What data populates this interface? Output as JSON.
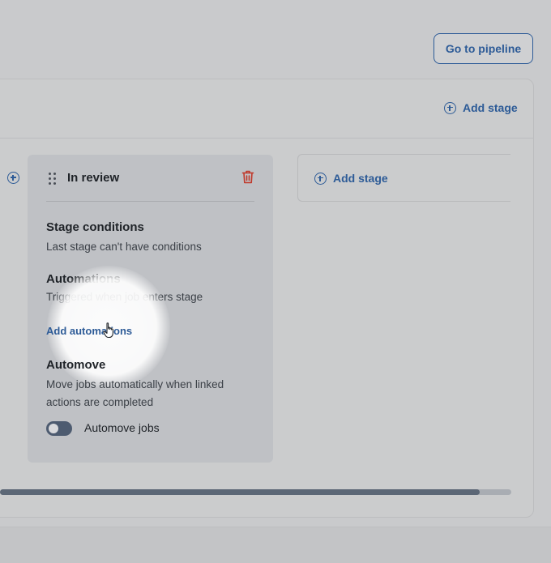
{
  "header": {
    "go_pipeline_label": "Go to pipeline",
    "add_stage_label": "Add stage"
  },
  "stage_card": {
    "title": "In review",
    "conditions": {
      "title": "Stage conditions",
      "text": "Last stage can't have conditions"
    },
    "automations": {
      "title": "Automations",
      "text": "Triggered when job enters stage",
      "link": "Add automations"
    },
    "automove": {
      "title": "Automove",
      "text_line1": "Move jobs automatically when linked",
      "text_line2": "actions are completed",
      "toggle_label": "Automove jobs",
      "toggle_on": false
    }
  },
  "next_stage": {
    "add_stage_label": "Add stage"
  },
  "colors": {
    "accent": "#2d5b97",
    "danger": "#c0392b",
    "toggle_off": "#4d5b70"
  },
  "scrollbar": {
    "position_fraction": 0.94
  }
}
